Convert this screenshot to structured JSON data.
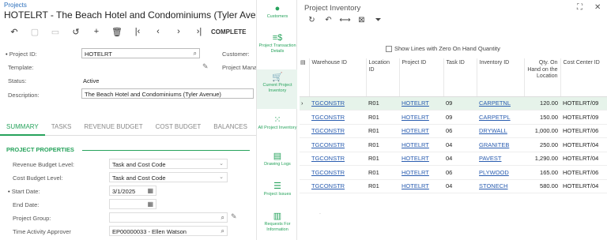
{
  "left": {
    "breadcrumb": "Projects",
    "title": "HOTELRT - The Beach Hotel and Condominiums (Tyler Avenue)",
    "toolbar": {
      "complete_label": "COMPLETE"
    },
    "form": {
      "project_id_label": "Project ID:",
      "project_id_value": "HOTELRT",
      "customer_label": "Customer:",
      "template_label": "Template:",
      "project_manager_label": "Project Mana",
      "status_label": "Status:",
      "status_value": "Active",
      "description_label": "Description:",
      "description_value": "The Beach Hotel and Condominiums (Tyler Avenue)"
    },
    "tabs": [
      "SUMMARY",
      "TASKS",
      "REVENUE BUDGET",
      "COST BUDGET",
      "BALANCES"
    ],
    "section_title": "PROJECT PROPERTIES",
    "props": {
      "revenue_budget_level_label": "Revenue Budget Level:",
      "revenue_budget_level_value": "Task and Cost Code",
      "cost_budget_level_label": "Cost Budget Level:",
      "cost_budget_level_value": "Task and Cost Code",
      "start_date_label": "Start Date:",
      "start_date_value": "3/1/2025",
      "end_date_label": "End Date:",
      "end_date_value": "",
      "project_group_label": "Project Group:",
      "project_group_value": "",
      "time_activity_approver_label": "Time Activity Approver",
      "time_activity_approver_value": "EP00000033 - Ellen Watson"
    }
  },
  "sidenav": [
    {
      "label": "Customers",
      "icon": "person-icon"
    },
    {
      "label": "Project Transaction Details",
      "icon": "dollar-list-icon"
    },
    {
      "label": "Current Project Inventory",
      "icon": "cart-icon"
    },
    {
      "label": "All Project Inventory",
      "icon": "grid-icon"
    },
    {
      "label": "Drawing Logs",
      "icon": "document-icon"
    },
    {
      "label": "Project Issues",
      "icon": "issues-icon"
    },
    {
      "label": "Requests For Information",
      "icon": "book-icon"
    }
  ],
  "panel": {
    "title": "Project Inventory",
    "zero_checkbox_label": "Show Lines with Zero On Hand Quantity",
    "columns": [
      "Warehouse ID",
      "Location ID",
      "Project ID",
      "Task ID",
      "Inventory ID",
      "Qty. On Hand on the Location",
      "Cost Center ID"
    ],
    "rows": [
      [
        "TGCONSTR",
        "R01",
        "HOTELRT",
        "09",
        "CARPETNL",
        "120.00",
        "HOTELRT/09"
      ],
      [
        "TGCONSTR",
        "R01",
        "HOTELRT",
        "09",
        "CARPETPL",
        "150.00",
        "HOTELRT/09"
      ],
      [
        "TGCONSTR",
        "R01",
        "HOTELRT",
        "06",
        "DRYWALL",
        "1,000.00",
        "HOTELRT/06"
      ],
      [
        "TGCONSTR",
        "R01",
        "HOTELRT",
        "04",
        "GRANITEB",
        "250.00",
        "HOTELRT/04"
      ],
      [
        "TGCONSTR",
        "R01",
        "HOTELRT",
        "04",
        "PAVEST",
        "1,290.00",
        "HOTELRT/04"
      ],
      [
        "TGCONSTR",
        "R01",
        "HOTELRT",
        "06",
        "PLYWOOD",
        "165.00",
        "HOTELRT/06"
      ],
      [
        "TGCONSTR",
        "R01",
        "HOTELRT",
        "04",
        "STONECH",
        "580.00",
        "HOTELRT/04"
      ]
    ],
    "footer_mark": "."
  },
  "colors": {
    "accent": "#27a35c",
    "link": "#2a5db0",
    "selected_row": "#e6f3ea"
  }
}
